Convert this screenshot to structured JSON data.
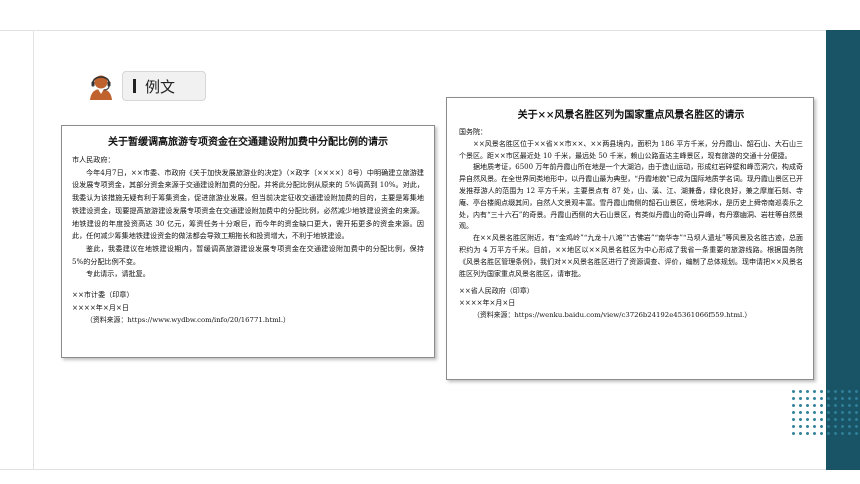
{
  "header": {
    "label": "例文"
  },
  "doc_left": {
    "title": "关于暂缓调高旅游专项资金在交通建设附加费中分配比例的请示",
    "salutation": "市人民政府：",
    "body": [
      "今年4月7日，××市委、市政府《关于加快发展旅游业的决定》（×政字〔××××〕8号）中明确建立旅游建设发展专项资金，其部分资金来源于交通建设附加费的分配，并将此分配比例从原来的 5%调高到 10%。对此，我委认为该措施无疑有利于筹集资金，促进旅游业发展。但当前决定征收交通建设附加费的目的，主要是筹集地铁建设资金，现要提高旅游建设发展专项资金在交通建设附加费中的分配比例，必然减少地铁建设资金的来源。地铁建设的年度投资高达 30 亿元，筹资任务十分艰巨，而今年的资金缺口更大，需开拓更多的资金来源。因此，任何减少筹集地铁建设资金的做法都会导致工期拖长和投资增大，不利于地铁建设。",
      "鉴此，我委建议在地铁建设期内，暂缓调高旅游建设发展专项资金在交通建设附加费中的分配比例，保持 5%的分配比例不变。",
      "专此请示，请批复。"
    ],
    "signature": "××市计委（印章）",
    "date": "××××年×月×日",
    "source": "（资料来源：https://www.wydbw.com/info/20/16771.html.）"
  },
  "doc_right": {
    "title": "关于××风景名胜区列为国家重点风景名胜区的请示",
    "salutation": "国务院：",
    "body": [
      "××风景名胜区位于××省××市××、××两县境内，面积为 186 平方千米，分丹霞山、韶石山、大石山三个景区。距××市区最近处 10 千米，最远处 50 千米，赖山公路直达主峰景区，现有旅游的交通十分便捷。",
      "据地质考证，6500 万年前丹霞山所在地是一个大湖泊，由于造山运动，形成红岩碎壁和峰峦洞穴，构成奇异自然风景。在全世界同类地形中，以丹霞山最为典型，“丹霞地貌”已成为国际地质学名词。现丹霞山景区已开发推荐游人的范围为 12 平方千米，主要景点有 87 处，山、溪、江、湖兼备，绿化良好，兼之摩崖石刻、寺庵、亭台楼阁点缀其间，自然人文景观丰富。雪丹霞山南侧的韶石山景区，傍地洞水，是历史上舜帝南巡奏乐之处，内有“三十六石”的奇景。丹霞山西侧的大石山景区，有类似丹霞山的奇山异峰，有丹寨幽洞、岩柱等自然景观。",
      "在××风景名胜区附近，有“金鸡岭”“九龙十八滩”“古佛岩”“南华寺”“马坝人遗址”等风景及名胜古迹，总面积约为 4 万平方千米。目前，××地区以××风景名胜区为中心形成了我省一条重要的旅游线路。根据国务院《风景名胜区管理条例》，我们对××风景名胜区进行了资源调查、评价，编制了总体规划。现申请把××风景名胜区列为国家重点风景名胜区，请审批。"
    ],
    "signature": "××省人民政府（印章）",
    "date": "××××年×月×日",
    "source": "（资料来源：https://wenku.baidu.com/view/c3726b24192e45361066f559.html.）"
  },
  "colors": {
    "accent": "#185366",
    "dots": "#2f7f99",
    "avatar": "#c0622d"
  }
}
